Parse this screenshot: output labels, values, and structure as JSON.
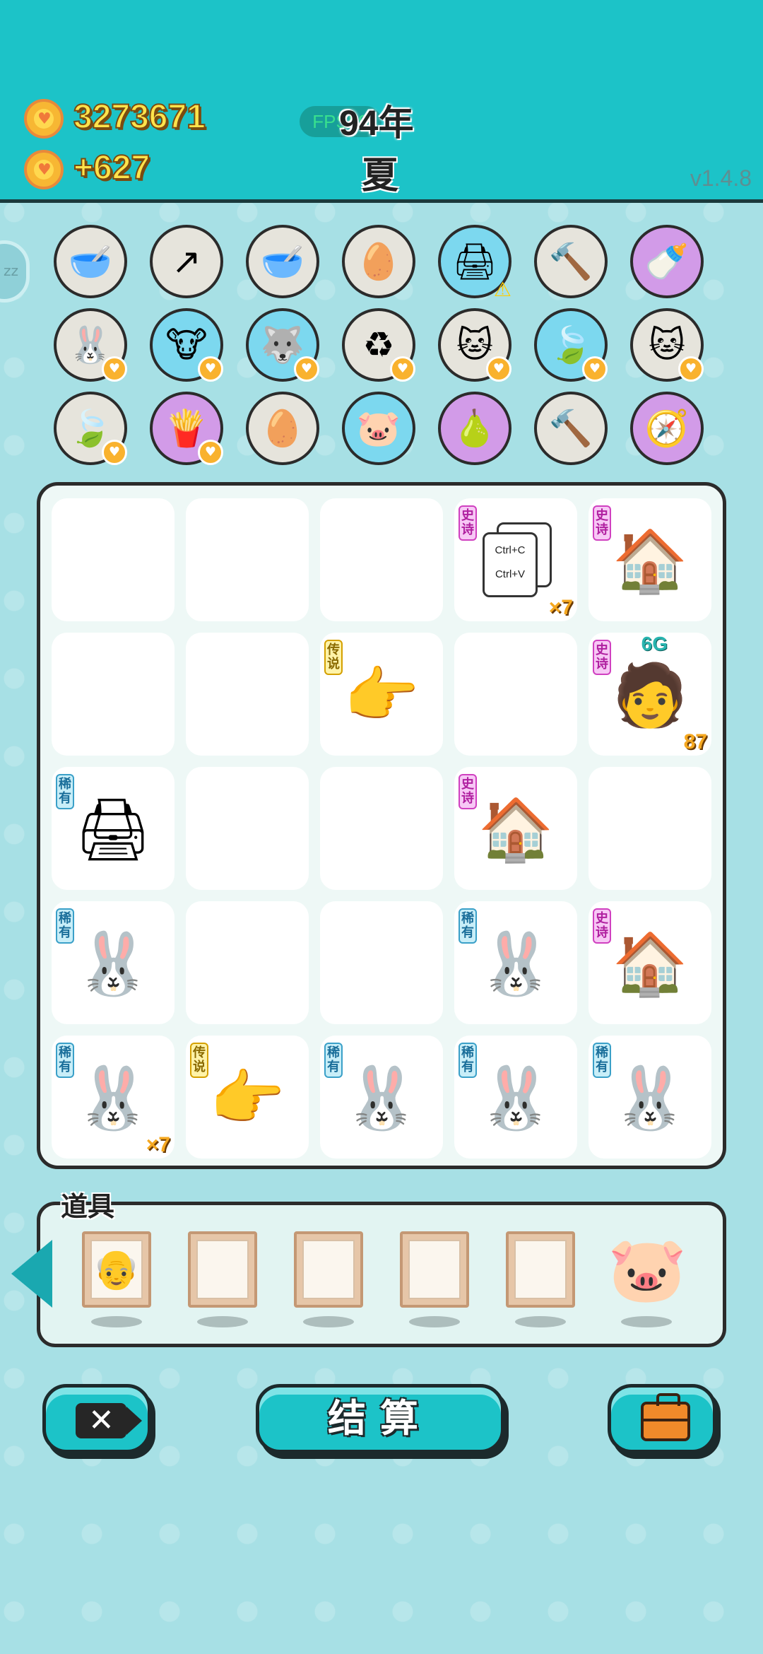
{
  "header": {
    "coins": "3273671",
    "income": "+627",
    "fps": "FPS59",
    "year": "94年",
    "season": "夏",
    "version": "v1.4.8"
  },
  "sidebar": {
    "label": "zz"
  },
  "tokens_row1": [
    {
      "name": "pet-bowl-icon",
      "glyph": "🥣",
      "style": "gray"
    },
    {
      "name": "upgrade-arrow-icon",
      "glyph": "↗",
      "style": "gray"
    },
    {
      "name": "pet-bowl-icon",
      "glyph": "🥣",
      "style": "gray"
    },
    {
      "name": "egg-tray-icon",
      "glyph": "🥚",
      "style": "gray"
    },
    {
      "name": "printer-icon",
      "glyph": "🖨",
      "style": "blue",
      "warn": "⚠"
    },
    {
      "name": "hammer-icon",
      "glyph": "🔨",
      "style": "gray"
    },
    {
      "name": "breast-pump-icon",
      "glyph": "🍼",
      "style": "purple"
    }
  ],
  "tokens_row2": [
    {
      "name": "rabbit-icon",
      "glyph": "🐰",
      "style": "gray",
      "badge": "♥"
    },
    {
      "name": "cows-icon",
      "glyph": "🐮",
      "style": "blue",
      "badge": "♥"
    },
    {
      "name": "husky-icon",
      "glyph": "🐺",
      "style": "blue",
      "badge": "♥"
    },
    {
      "name": "recycle-icon",
      "glyph": "♻",
      "style": "gray",
      "badge": "♥"
    },
    {
      "name": "cats-icon",
      "glyph": "🐱",
      "style": "gray",
      "badge": "♥"
    },
    {
      "name": "leaf-icon",
      "glyph": "🍃",
      "style": "blue",
      "badge": "♥"
    },
    {
      "name": "cats-icon",
      "glyph": "🐱",
      "style": "gray",
      "badge": "♥"
    }
  ],
  "tokens_row3": [
    {
      "name": "leaf-icon",
      "glyph": "🍃",
      "style": "gray",
      "badge": "♥"
    },
    {
      "name": "fries-icon",
      "glyph": "🍟",
      "style": "purple",
      "badge": "♥"
    },
    {
      "name": "egg-tray-icon",
      "glyph": "🥚",
      "style": "gray"
    },
    {
      "name": "piggy-bank-icon",
      "glyph": "🐷",
      "style": "blue"
    },
    {
      "name": "pomelo-icon",
      "glyph": "🍐",
      "style": "purple"
    },
    {
      "name": "hammer-icon",
      "glyph": "🔨",
      "style": "gray"
    },
    {
      "name": "compass-icon",
      "glyph": "🧭",
      "style": "purple"
    }
  ],
  "tags": {
    "epic": "史诗",
    "legend": "传说",
    "rare": "稀有"
  },
  "board": {
    "copy_text_1": "Ctrl+C",
    "copy_text_2": "Ctrl+V",
    "copy_count": "×7",
    "person_level": "6G",
    "person_count": "87",
    "rabbit_count": "×7"
  },
  "items": {
    "title": "道具"
  },
  "buttons": {
    "settle": "结算"
  },
  "colors": {
    "header": "#1cc3c8",
    "coin_text": "#ffe34b",
    "epic": "#d040c0",
    "legend": "#d4a000",
    "rare": "#3aa0c8"
  }
}
